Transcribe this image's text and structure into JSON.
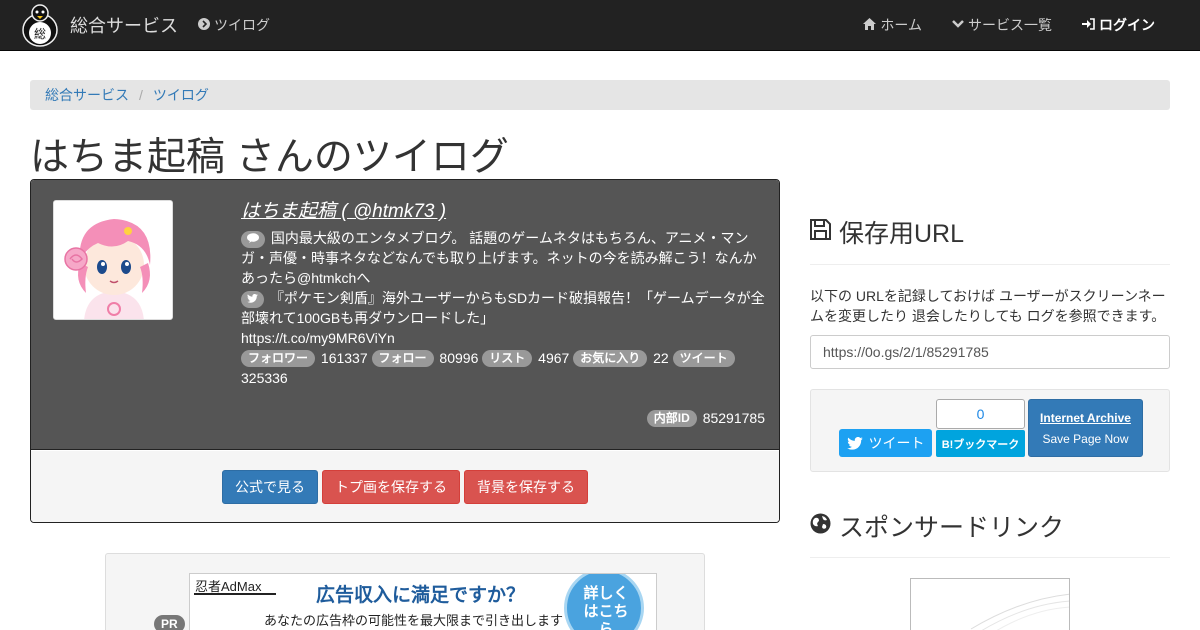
{
  "navbar": {
    "brand": "総合サービス",
    "logo_icon": "penguin-logo-icon",
    "logo_char": "総",
    "left_item": "ツイログ",
    "right_items": [
      {
        "label": "ホーム",
        "icon": "home-icon"
      },
      {
        "label": "サービス一覧",
        "icon": "chevron-down-icon"
      },
      {
        "label": "ログイン",
        "icon": "sign-in-icon"
      }
    ]
  },
  "breadcrumb": [
    "総合サービス",
    "ツイログ"
  ],
  "page_title": "はちま起稿 さんのツイログ",
  "profile": {
    "name": "はちま起稿 ( @htmk73 )",
    "bio": "国内最大級のエンタメブログ。 話題のゲームネタはもちろん、アニメ・マンガ・声優・時事ネタなどなんでも取り上げます。ネットの今を読み解こう！なんかあったら@htmkchへ",
    "latest_tweet": "『ポケモン剣盾』海外ユーザーからもSDカード破損報告！「ゲームデータが全部壊れて100GBも再ダウンロードした」",
    "tweet_link": "https://t.co/my9MR6ViYn",
    "stats": [
      {
        "label": "フォロワー",
        "value": "161337"
      },
      {
        "label": "フォロー",
        "value": "80996"
      },
      {
        "label": "リスト",
        "value": "4967"
      },
      {
        "label": "お気に入り",
        "value": "22"
      },
      {
        "label": "ツイート",
        "value": "325336"
      }
    ],
    "internal_id_label": "内部ID",
    "internal_id": "85291785"
  },
  "actions": {
    "official": "公式で見る",
    "save_icon": "トプ画を保存する",
    "save_bg": "背景を保存する"
  },
  "ad": {
    "pr": "PR",
    "ninja": "忍者AdMax",
    "headline": "広告収入に満足ですか？",
    "sub": "あなたの広告枠の可能性を最大限まで引き出します",
    "circle": "詳しくはこちら"
  },
  "sidebar": {
    "save_heading": "保存用URL",
    "save_desc": "以下の URLを記録しておけば ユーザーがスクリーンネームを変更したり 退会したりしても ログを参照できます。",
    "save_url": "https://0o.gs/2/1/85291785",
    "tweet_button": "ツイート",
    "hatena_count": "0",
    "hatena_button": "B!ブックマーク",
    "archive_title": "Internet Archive",
    "archive_sub": "Save Page Now",
    "sponsor_heading": "スポンサードリンク"
  },
  "colors": {
    "navbar_bg": "#222222",
    "panel_bg": "#555555",
    "primary": "#337ab7",
    "danger": "#d9534f",
    "twitter": "#1da1f2",
    "hatena": "#00a4de"
  }
}
